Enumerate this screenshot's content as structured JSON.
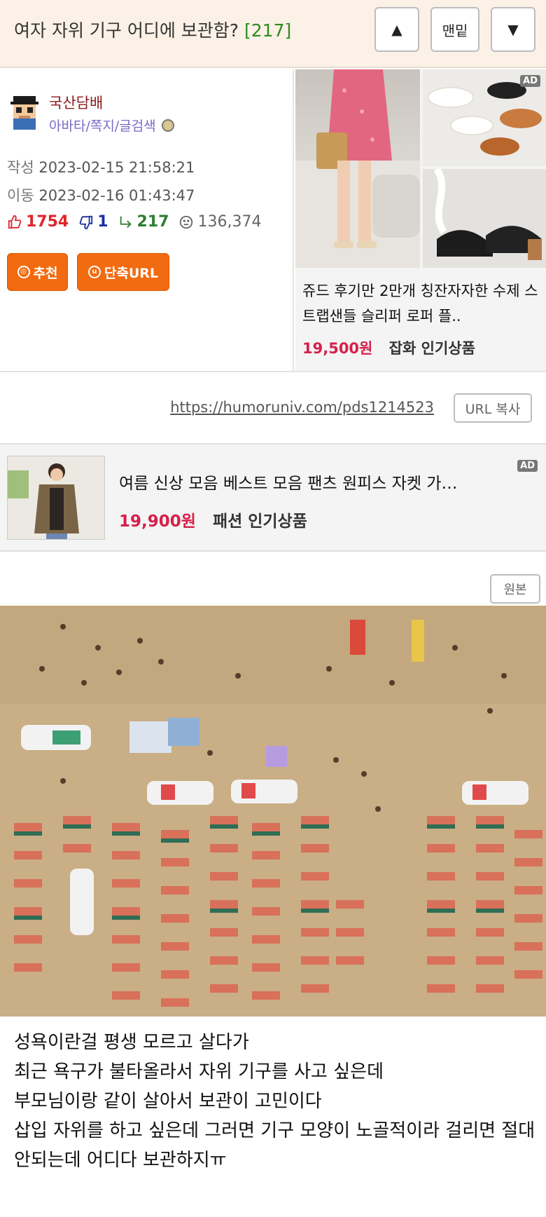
{
  "header": {
    "title": "여자 자위 기구 어디에 보관함?",
    "count": "[217]",
    "up_label": "▲",
    "top_label": "맨밑",
    "down_label": "▼"
  },
  "post": {
    "author": "국산담배",
    "author_links": "아바타/쪽지/글검색",
    "written_label": "작성",
    "written_value": "2023-02-15 21:58:21",
    "moved_label": "이동",
    "moved_value": "2023-02-16 01:43:47",
    "upvotes": "1754",
    "downvotes": "1",
    "replies": "217",
    "views": "136,374",
    "recommend_label": "추천",
    "short_url_label": "단축URL"
  },
  "ad_top": {
    "label": "AD",
    "text": "쥬드 후기만 2만개 칭잔자자한 수제 스트랩샌들 슬리퍼 로퍼 플..",
    "price": "19,500원",
    "category": "잡화 인기상품"
  },
  "url_row": {
    "url": "https://humoruniv.com/pds1214523",
    "copy_label": "URL 복사"
  },
  "ad_mid": {
    "label": "AD",
    "text": "여름 신상 모음 베스트 모음 팬츠 원피스 자켓 가…",
    "price": "19,900원",
    "category": "패션 인기상품"
  },
  "original_label": "원본",
  "body": {
    "lines": [
      "성욕이란걸 평생 모르고 살다가",
      "최근 욕구가 불타올라서 자위 기구를 사고 싶은데",
      "부모님이랑 같이 살아서 보관이 고민이다",
      "삽입 자위를 하고 싶은데 그러면 기구 모양이 노골적이라 걸리면 절대",
      "안되는데 어디다 보관하지ㅠ"
    ]
  },
  "colors": {
    "header_bg": "#fbf1e6",
    "accent_orange": "#f26b10",
    "price_red": "#d6204b",
    "upvote_red": "#e0262b",
    "downvote_blue": "#1a2fa3",
    "reply_green": "#2e7d32"
  }
}
